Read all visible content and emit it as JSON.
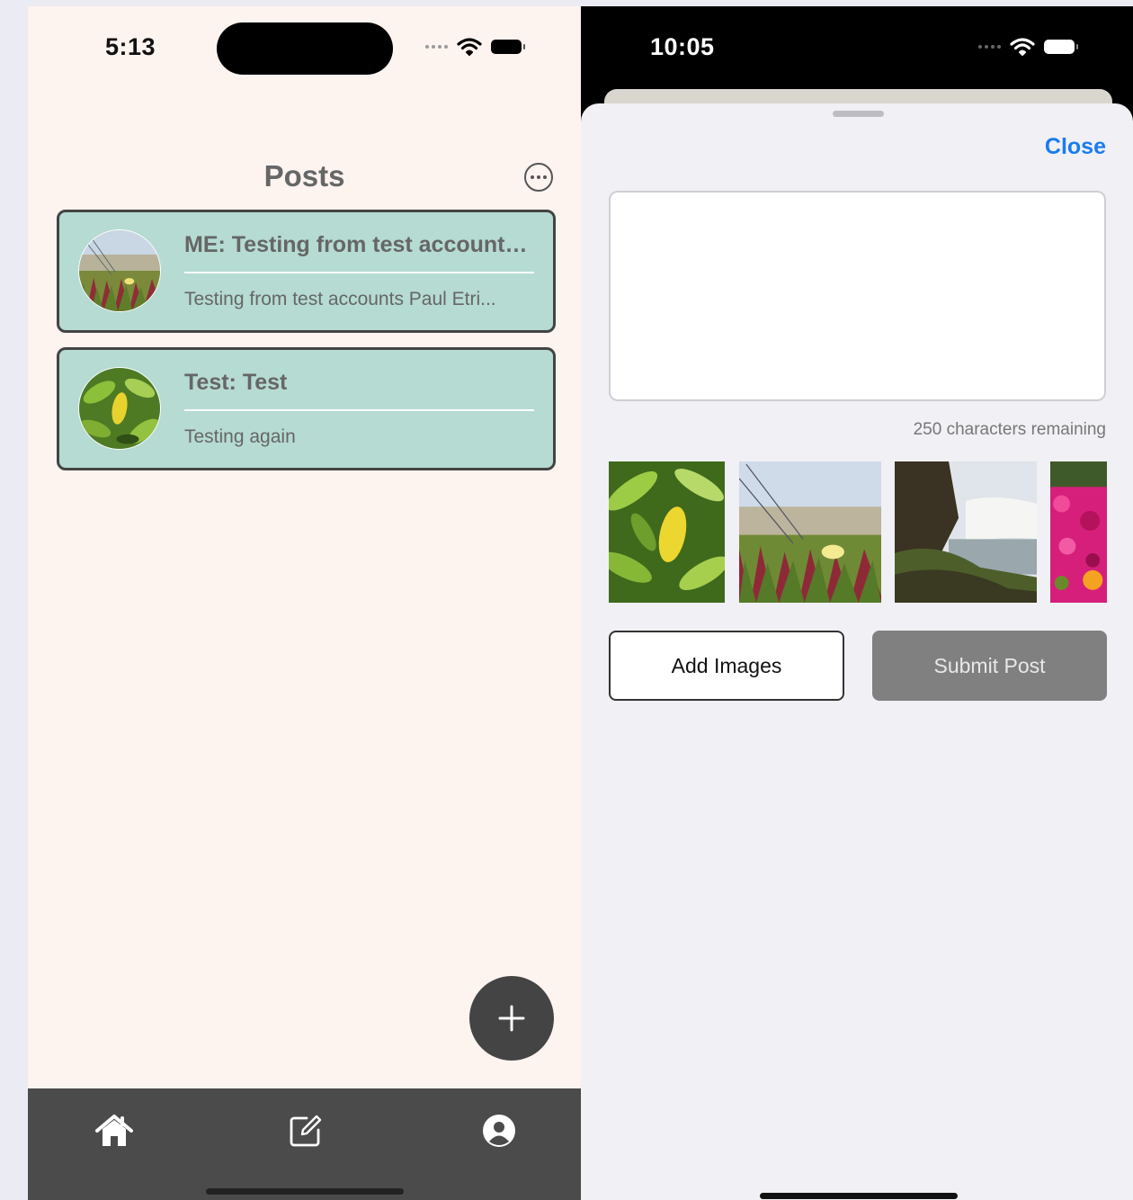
{
  "left_screen": {
    "status_bar": {
      "time": "5:13"
    },
    "header": {
      "title": "Posts",
      "more_icon": "ellipsis-circle-icon"
    },
    "posts": [
      {
        "title": "ME: Testing from test accounts Paul Etri...",
        "body": "Testing from test accounts Paul Etri...",
        "avatar": "dune-flower-photo"
      },
      {
        "title": "Test: Test",
        "body": "Testing again",
        "avatar": "lemon-leaf-photo"
      }
    ],
    "fab_icon": "plus-icon",
    "tab_bar": {
      "items": [
        "home-icon",
        "compose-icon",
        "profile-icon"
      ]
    }
  },
  "right_screen": {
    "status_bar": {
      "time": "10:05"
    },
    "sheet": {
      "close_label": "Close",
      "text_value": "",
      "chars_remaining": "250 characters remaining",
      "thumbnails": [
        "lemon-leaf-photo",
        "dune-flower-photo",
        "waterfall-photo",
        "pink-flowers-photo"
      ],
      "add_images_label": "Add Images",
      "submit_label": "Submit Post"
    }
  },
  "colors": {
    "left_background": "#fdf3ef",
    "card_fill": "#b5dbd2",
    "card_border": "#444444",
    "tab_bar": "#4b4b4b",
    "sheet_background": "#f0f0f5",
    "link_blue": "#1a7cf0",
    "submit_disabled": "#808080"
  }
}
